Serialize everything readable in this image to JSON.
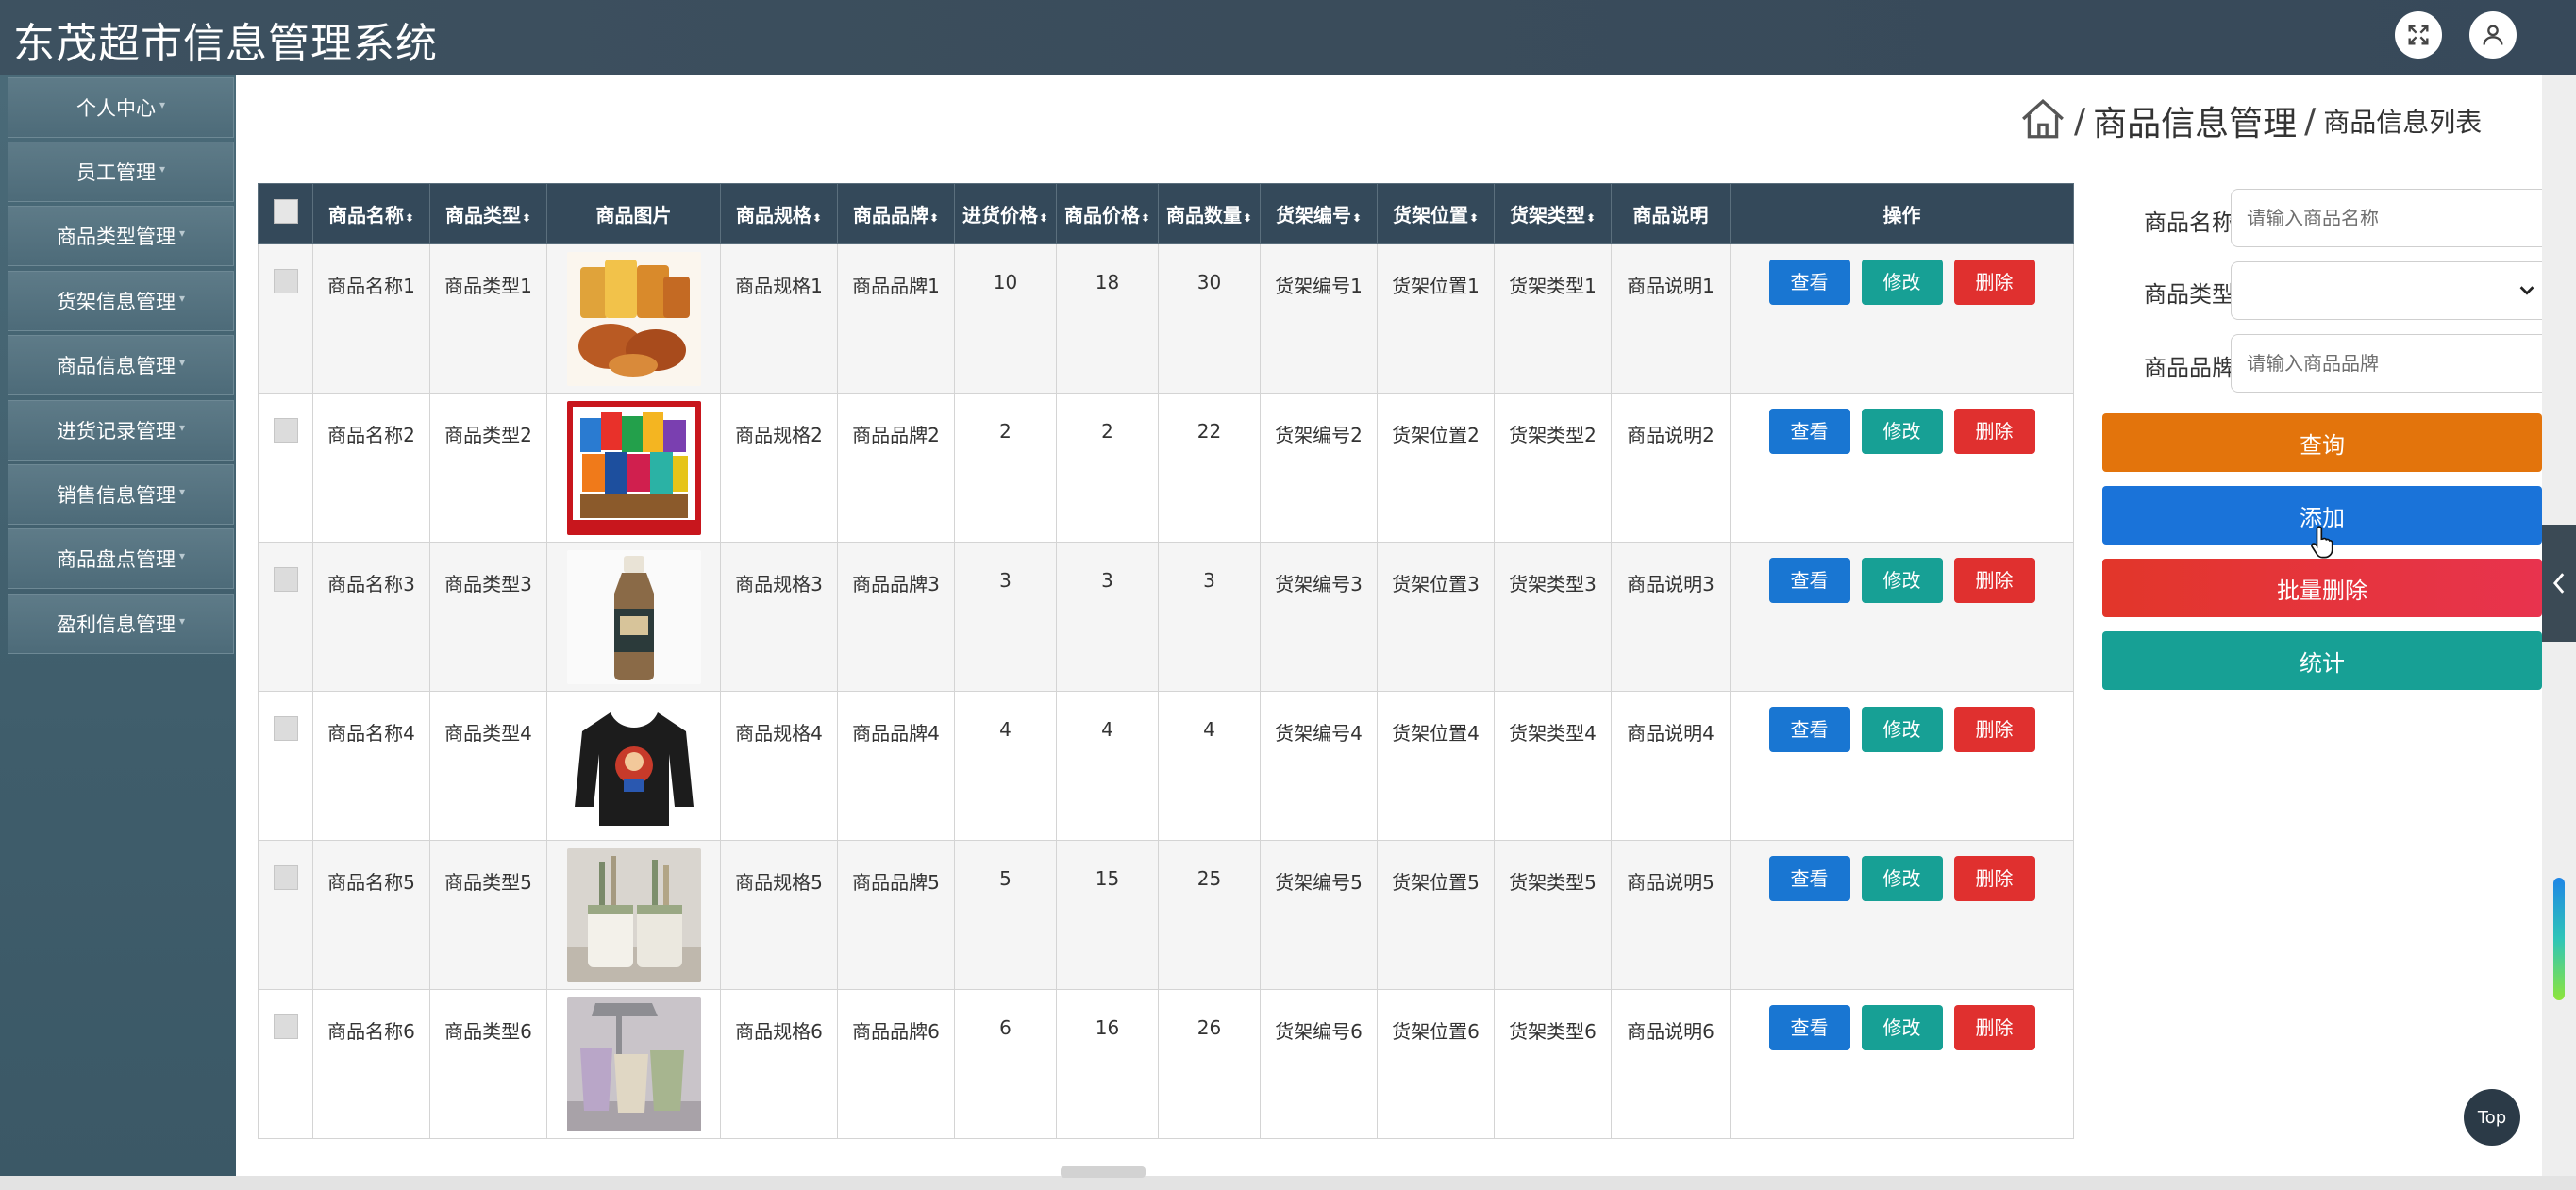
{
  "app": {
    "title": "东茂超市信息管理系统"
  },
  "sidebar": {
    "items": [
      {
        "label": "个人中心"
      },
      {
        "label": "员工管理"
      },
      {
        "label": "商品类型管理"
      },
      {
        "label": "货架信息管理"
      },
      {
        "label": "商品信息管理"
      },
      {
        "label": "进货记录管理"
      },
      {
        "label": "销售信息管理"
      },
      {
        "label": "商品盘点管理"
      },
      {
        "label": "盈利信息管理"
      }
    ]
  },
  "breadcrumb": {
    "sep": "/",
    "section": "商品信息管理",
    "page": "商品信息列表"
  },
  "table": {
    "headers": [
      "商品名称",
      "商品类型",
      "商品图片",
      "商品规格",
      "商品品牌",
      "进货价格",
      "商品价格",
      "商品数量",
      "货架编号",
      "货架位置",
      "货架类型",
      "商品说明",
      "操作"
    ],
    "rows": [
      {
        "name": "商品名称1",
        "type": "商品类型1",
        "spec": "商品规格1",
        "brand": "商品品牌1",
        "cost": "10",
        "price": "18",
        "qty": "30",
        "shelf_no": "货架编号1",
        "shelf_pos": "货架位置1",
        "shelf_type": "货架类型1",
        "desc": "商品说明1"
      },
      {
        "name": "商品名称2",
        "type": "商品类型2",
        "spec": "商品规格2",
        "brand": "商品品牌2",
        "cost": "2",
        "price": "2",
        "qty": "22",
        "shelf_no": "货架编号2",
        "shelf_pos": "货架位置2",
        "shelf_type": "货架类型2",
        "desc": "商品说明2"
      },
      {
        "name": "商品名称3",
        "type": "商品类型3",
        "spec": "商品规格3",
        "brand": "商品品牌3",
        "cost": "3",
        "price": "3",
        "qty": "3",
        "shelf_no": "货架编号3",
        "shelf_pos": "货架位置3",
        "shelf_type": "货架类型3",
        "desc": "商品说明3"
      },
      {
        "name": "商品名称4",
        "type": "商品类型4",
        "spec": "商品规格4",
        "brand": "商品品牌4",
        "cost": "4",
        "price": "4",
        "qty": "4",
        "shelf_no": "货架编号4",
        "shelf_pos": "货架位置4",
        "shelf_type": "货架类型4",
        "desc": "商品说明4"
      },
      {
        "name": "商品名称5",
        "type": "商品类型5",
        "spec": "商品规格5",
        "brand": "商品品牌5",
        "cost": "5",
        "price": "15",
        "qty": "25",
        "shelf_no": "货架编号5",
        "shelf_pos": "货架位置5",
        "shelf_type": "货架类型5",
        "desc": "商品说明5"
      },
      {
        "name": "商品名称6",
        "type": "商品类型6",
        "spec": "商品规格6",
        "brand": "商品品牌6",
        "cost": "6",
        "price": "16",
        "qty": "26",
        "shelf_no": "货架编号6",
        "shelf_pos": "货架位置6",
        "shelf_type": "货架类型6",
        "desc": "商品说明6"
      }
    ],
    "actions": {
      "view": "查看",
      "edit": "修改",
      "delete": "删除"
    }
  },
  "search": {
    "name_label": "商品名称",
    "name_placeholder": "请输入商品名称",
    "type_label": "商品类型",
    "type_value": "",
    "brand_label": "商品品牌",
    "brand_placeholder": "请输入商品品牌"
  },
  "buttons": {
    "query": "查询",
    "add": "添加",
    "batch_delete": "批量删除",
    "stats": "统计"
  },
  "top_button": "Top",
  "colors": {
    "header": "#3d5160",
    "view": "#1976d2",
    "edit": "#17a095",
    "delete": "#e0302f",
    "query": "#e3740c",
    "add": "#1a73d9",
    "stats": "#17a095"
  }
}
